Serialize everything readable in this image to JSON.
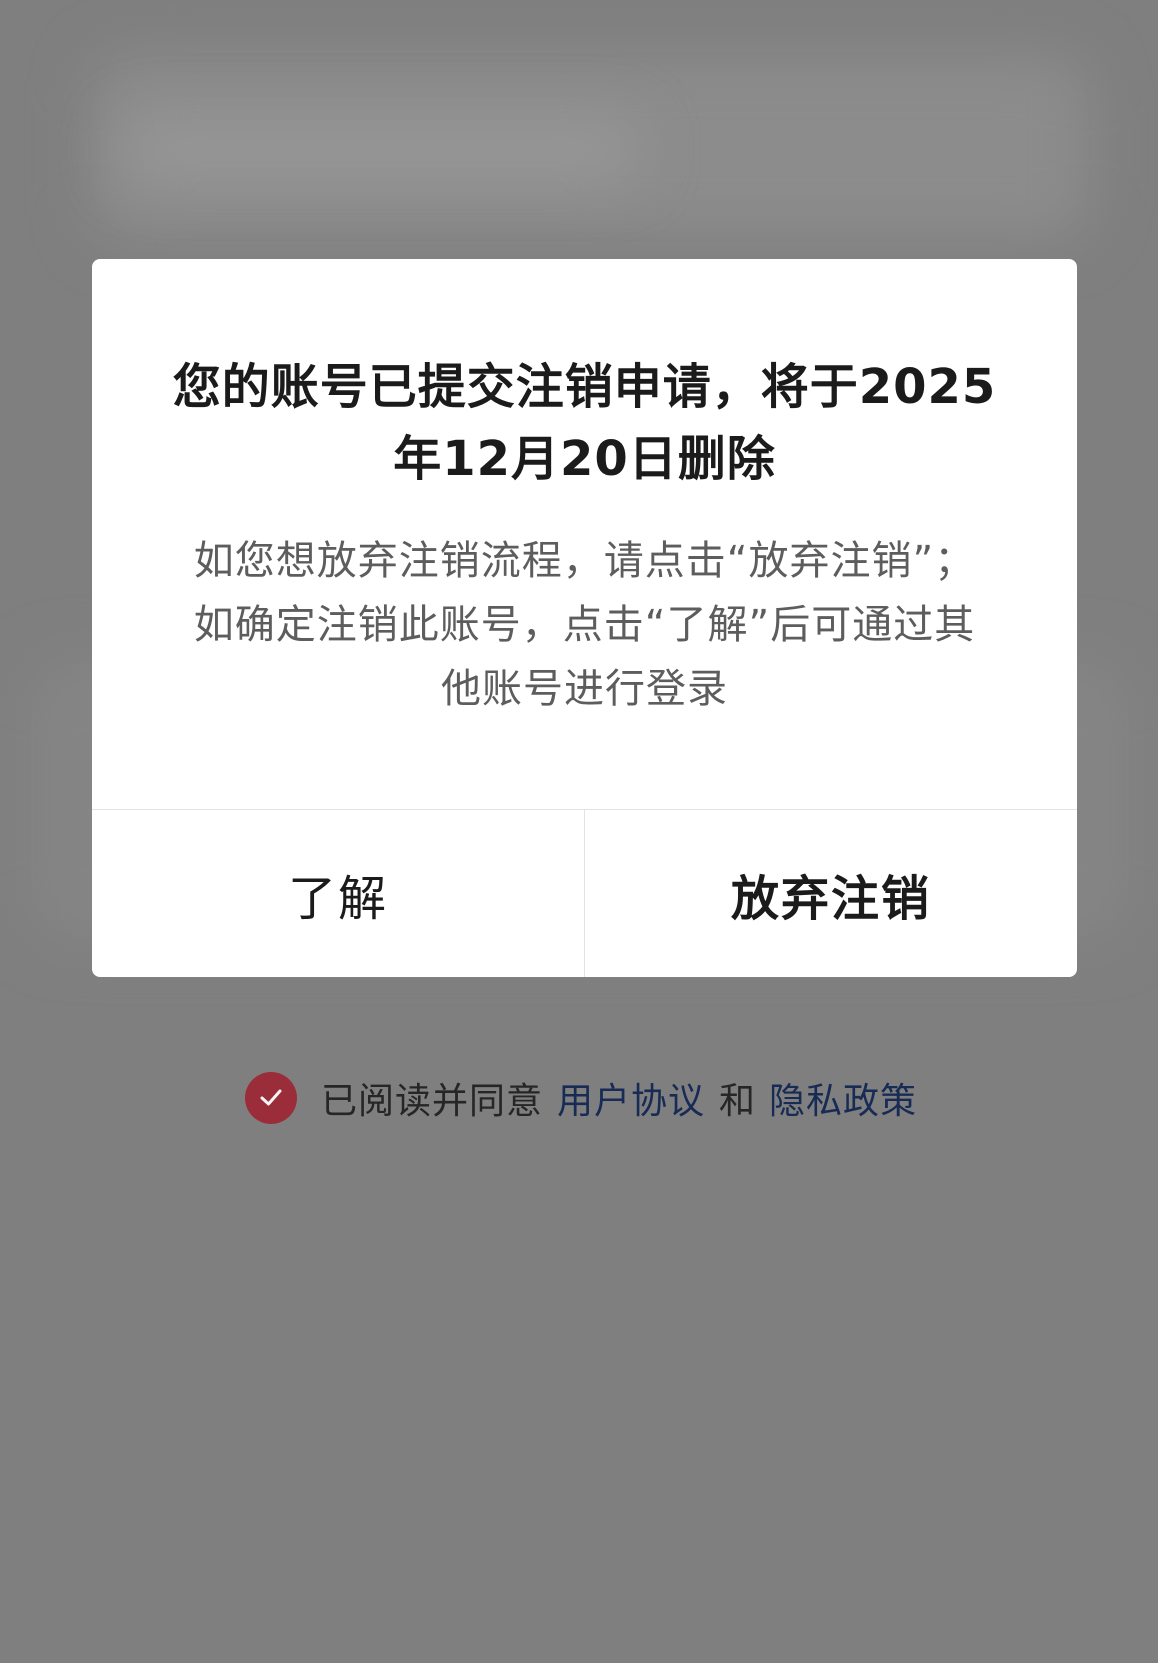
{
  "dialog": {
    "title": "您的账号已提交注销申请，将于2025年12月20日删除",
    "message": "如您想放弃注销流程，请点击“放弃注销”；如确定注销此账号，点击“了解”后可通过其他账号进行登录",
    "buttons": {
      "understand_label": "了解",
      "cancel_deletion_label": "放弃注销"
    }
  },
  "agreement": {
    "checked": true,
    "prefix_text": "已阅读并同意",
    "user_agreement_link": "用户协议",
    "conjunction": "和",
    "privacy_policy_link": "隐私政策"
  },
  "colors": {
    "overlay": "#7f7f7f",
    "dialog_background": "#ffffff",
    "title_text": "#1b1b1b",
    "message_text": "#5d5d5d",
    "checkbox_accent": "#9b2c3a",
    "link_text": "#172b55"
  },
  "icons": {
    "checkbox": "checkmark-circle-icon"
  }
}
